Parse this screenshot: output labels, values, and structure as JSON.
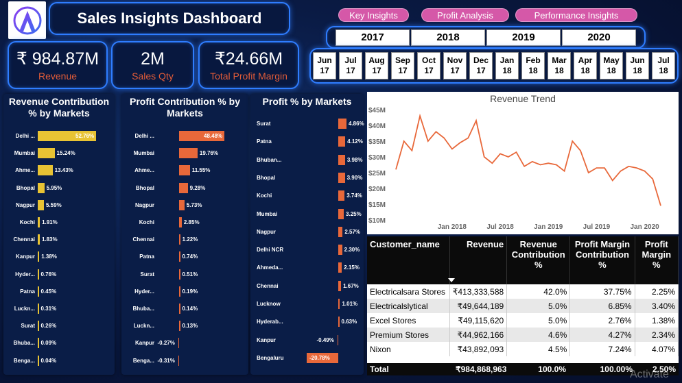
{
  "header": {
    "title": "Sales Insights Dashboard",
    "nav": [
      "Key Insights",
      "Profit Analysis",
      "Performance Insights"
    ],
    "years": [
      "2017",
      "2018",
      "2019",
      "2020"
    ],
    "months": [
      [
        "Jun",
        "17"
      ],
      [
        "Jul",
        "17"
      ],
      [
        "Aug",
        "17"
      ],
      [
        "Sep",
        "17"
      ],
      [
        "Oct",
        "17"
      ],
      [
        "Nov",
        "17"
      ],
      [
        "Dec",
        "17"
      ],
      [
        "Jan",
        "18"
      ],
      [
        "Feb",
        "18"
      ],
      [
        "Mar",
        "18"
      ],
      [
        "Apr",
        "18"
      ],
      [
        "May",
        "18"
      ],
      [
        "Jun",
        "18"
      ],
      [
        "Jul",
        "18"
      ]
    ]
  },
  "kpis": {
    "revenue": {
      "value": "₹ 984.87M",
      "label": "Revenue"
    },
    "sales_qty": {
      "value": "2M",
      "label": "Sales Qty"
    },
    "profit_margin": {
      "value": "₹24.66M",
      "label": "Total Profit Margin"
    }
  },
  "colors": {
    "accent": "#2f7dff",
    "revenue_bar": "#e8c334",
    "profit_bar": "#e8683a",
    "kpi_label": "#e25c38",
    "pill": "#d558a8"
  },
  "chart_data": [
    {
      "type": "bar",
      "title": "Revenue Contribution % by Markets",
      "orientation": "horizontal",
      "categories": [
        "Delhi ...",
        "Mumbai",
        "Ahme...",
        "Bhopal",
        "Nagpur",
        "Kochi",
        "Chennai",
        "Kanpur",
        "Hyder...",
        "Patna",
        "Luckn...",
        "Surat",
        "Bhuba...",
        "Benga..."
      ],
      "values": [
        52.76,
        15.24,
        13.43,
        5.95,
        5.59,
        1.91,
        1.83,
        1.38,
        0.76,
        0.45,
        0.31,
        0.26,
        0.09,
        0.04
      ],
      "labels": [
        "52.76%",
        "15.24%",
        "13.43%",
        "5.95%",
        "5.59%",
        "1.91%",
        "1.83%",
        "1.38%",
        "0.76%",
        "0.45%",
        "0.31%",
        "0.26%",
        "0.09%",
        "0.04%"
      ]
    },
    {
      "type": "bar",
      "title": "Profit Contribution % by Markets",
      "orientation": "horizontal",
      "categories": [
        "Delhi ...",
        "Mumbai",
        "Ahme...",
        "Bhopal",
        "Nagpur",
        "Kochi",
        "Chennai",
        "Patna",
        "Surat",
        "Hyder...",
        "Bhuba...",
        "Luckn...",
        "Kanpur",
        "Benga..."
      ],
      "values": [
        48.48,
        19.76,
        11.55,
        9.28,
        5.73,
        2.85,
        1.22,
        0.74,
        0.51,
        0.19,
        0.14,
        0.13,
        -0.27,
        -0.31
      ],
      "labels": [
        "48.48%",
        "19.76%",
        "11.55%",
        "9.28%",
        "5.73%",
        "2.85%",
        "1.22%",
        "0.74%",
        "0.51%",
        "0.19%",
        "0.14%",
        "0.13%",
        "-0.27%",
        "-0.31%"
      ]
    },
    {
      "type": "bar",
      "title": "Profit % by Markets",
      "orientation": "horizontal",
      "categories": [
        "Surat",
        "Patna",
        "Bhuban...",
        "Bhopal",
        "Kochi",
        "Mumbai",
        "Nagpur",
        "Delhi NCR",
        "Ahmeda...",
        "Chennai",
        "Lucknow",
        "Hyderab...",
        "Kanpur",
        "Bengaluru"
      ],
      "values": [
        4.86,
        4.12,
        3.98,
        3.9,
        3.74,
        3.25,
        2.57,
        2.3,
        2.15,
        1.67,
        1.01,
        0.63,
        -0.49,
        -20.78
      ],
      "labels": [
        "4.86%",
        "4.12%",
        "3.98%",
        "3.90%",
        "3.74%",
        "3.25%",
        "2.57%",
        "2.30%",
        "2.15%",
        "1.67%",
        "1.01%",
        "0.63%",
        "-0.49%",
        "-20.78%"
      ]
    },
    {
      "type": "line",
      "title": "Revenue Trend",
      "y_ticks": [
        "$45M",
        "$40M",
        "$35M",
        "$30M",
        "$25M",
        "$20M",
        "$15M",
        "$10M"
      ],
      "ylim": [
        10,
        45
      ],
      "x_ticks": [
        "Jan 2018",
        "Jul 2018",
        "Jan 2019",
        "Jul 2019",
        "Jan 2020"
      ],
      "x_tick_index": [
        7,
        13,
        19,
        25,
        31
      ],
      "series": [
        {
          "values": [
            26,
            35,
            32,
            43,
            35,
            38,
            36,
            32.5,
            34.5,
            36,
            41.5,
            30,
            28,
            31,
            30,
            31.5,
            27,
            28.5,
            27.5,
            28,
            27.5,
            25.5,
            35,
            32,
            25,
            26.5,
            26.5,
            22.5,
            25.5,
            27,
            26.5,
            25.5,
            23,
            14.5
          ]
        }
      ]
    }
  ],
  "table": {
    "columns": [
      "Customer_name",
      "Revenue",
      "Revenue Contribution %",
      "Profit Margin Contribution %",
      "Profit Margin %"
    ],
    "rows": [
      [
        "Electricalsara Stores",
        "₹413,333,588",
        "42.0%",
        "37.75%",
        "2.25%"
      ],
      [
        "Electricalslytical",
        "₹49,644,189",
        "5.0%",
        "6.85%",
        "3.40%"
      ],
      [
        "Excel Stores",
        "₹49,115,620",
        "5.0%",
        "2.76%",
        "1.38%"
      ],
      [
        "Premium Stores",
        "₹44,962,166",
        "4.6%",
        "4.27%",
        "2.34%"
      ],
      [
        "Nixon",
        "₹43,892,093",
        "4.5%",
        "7.24%",
        "4.07%"
      ]
    ],
    "total": [
      "Total",
      "₹984,868,963",
      "100.0%",
      "100.00%",
      "2.50%"
    ]
  },
  "watermark": "Activate"
}
